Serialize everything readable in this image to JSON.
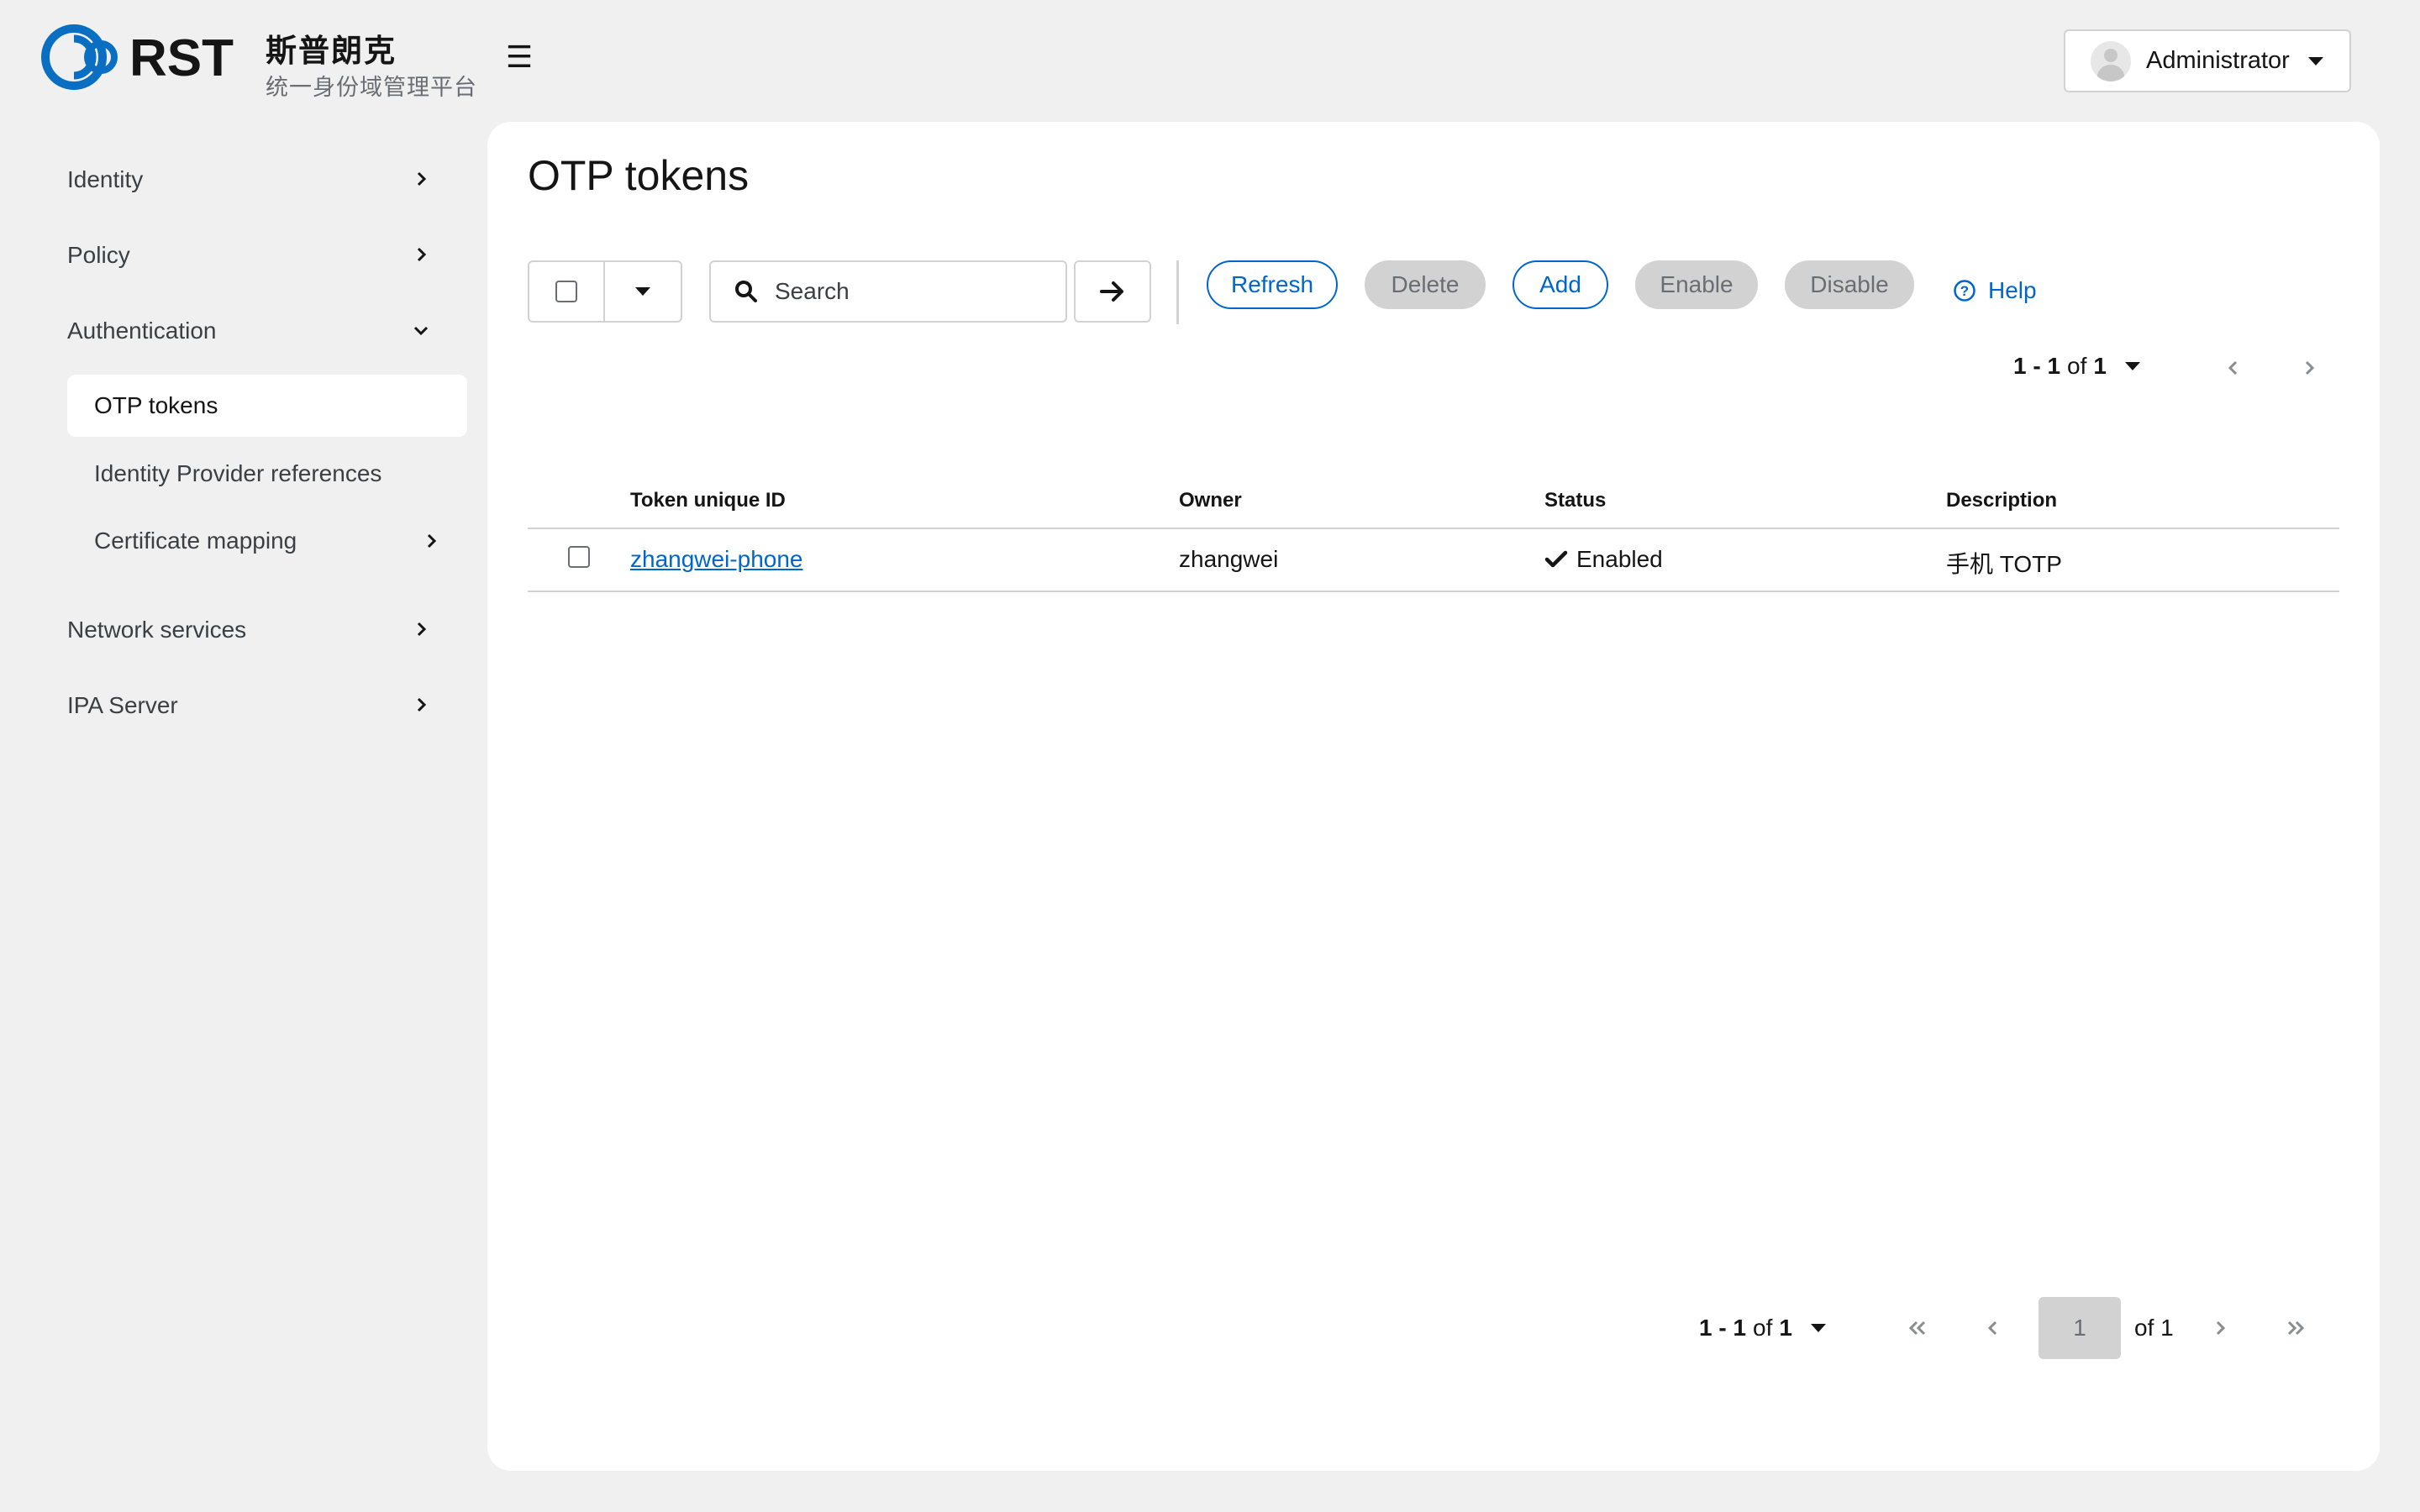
{
  "brand": {
    "logo_text": "RST",
    "title": "斯普朗克",
    "subtitle": "统一身份域管理平台"
  },
  "header": {
    "menu_icon": "hamburger-icon",
    "user_name": "Administrator"
  },
  "sidebar": {
    "items": [
      {
        "label": "Identity",
        "icon": "chevron-right-icon"
      },
      {
        "label": "Policy",
        "icon": "chevron-right-icon"
      },
      {
        "label": "Authentication",
        "icon": "chevron-down-icon",
        "expanded": true
      },
      {
        "label": "Network services",
        "icon": "chevron-right-icon"
      },
      {
        "label": "IPA Server",
        "icon": "chevron-right-icon"
      }
    ],
    "sub_items": [
      {
        "label": "OTP tokens",
        "active": true
      },
      {
        "label": "Identity Provider references"
      },
      {
        "label": "Certificate mapping",
        "icon": "chevron-right-icon"
      }
    ]
  },
  "main": {
    "title": "OTP tokens",
    "search": {
      "placeholder": "Search",
      "value": ""
    },
    "actions": {
      "refresh": "Refresh",
      "delete": "Delete",
      "add": "Add",
      "enable": "Enable",
      "disable": "Disable",
      "help": "Help"
    },
    "pagination_top": {
      "range_start": "1",
      "range_sep": " - ",
      "range_end": "1",
      "of": "of",
      "total": "1"
    },
    "table": {
      "columns": [
        "Token unique ID",
        "Owner",
        "Status",
        "Description"
      ],
      "rows": [
        {
          "token_id": "zhangwei-phone",
          "owner": "zhangwei",
          "status": "Enabled",
          "description": "手机 TOTP"
        }
      ]
    },
    "pagination_bottom": {
      "range_start": "1",
      "range_sep": " - ",
      "range_end": "1",
      "of": "of",
      "total": "1",
      "current_page": "1",
      "page_of": "of 1"
    }
  },
  "colors": {
    "accent": "#0066cc",
    "background": "#f0f0f0",
    "panel": "#ffffff",
    "disabled": "#d2d2d2",
    "logo_blue": "#0a6fc2"
  }
}
